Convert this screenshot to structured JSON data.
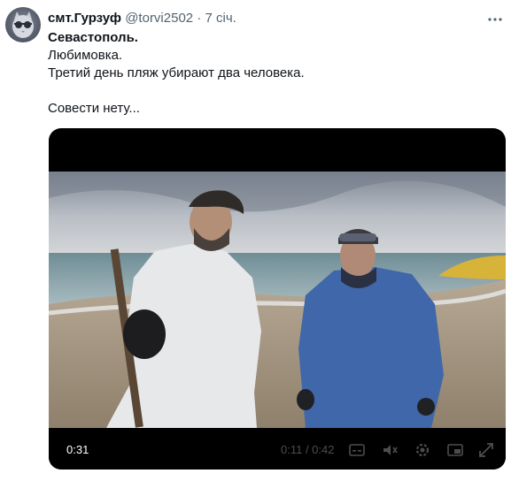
{
  "tweet": {
    "author_name": "смт.Гурзуф",
    "handle": "@torvi2502",
    "separator": "·",
    "date": "7 січ.",
    "lines": [
      "Севастополь.",
      "Любимовка.",
      "Третий день пляж убирают два человека.",
      "",
      "Совести нету..."
    ]
  },
  "video": {
    "elapsed": "0:31",
    "progress": "0:11 / 0:42",
    "icons": [
      "subtitles-icon",
      "volume-icon",
      "settings-icon",
      "pip-icon",
      "fullscreen-icon"
    ]
  },
  "colors": {
    "text": "#0f1419",
    "secondary": "#536471",
    "video_bg": "#000000"
  }
}
